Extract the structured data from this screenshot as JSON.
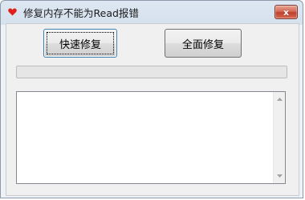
{
  "window": {
    "title": "修复内存不能为Read报错",
    "close_label": "x"
  },
  "buttons": {
    "quick_repair": "快速修复",
    "full_repair": "全面修复"
  },
  "progress": {
    "value": 0
  },
  "log": {
    "text": ""
  },
  "colors": {
    "icon": "#e0201c",
    "close": "#c7432f"
  }
}
